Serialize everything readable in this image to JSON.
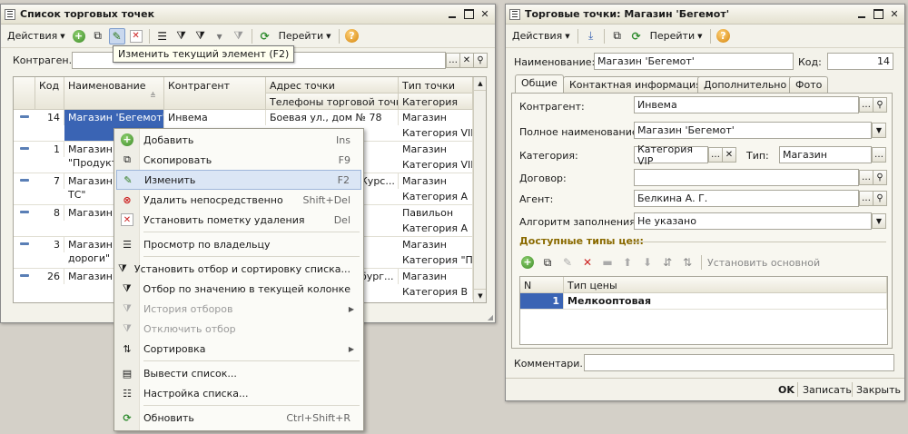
{
  "left_window": {
    "title": "Список торговых точек",
    "toolbar": {
      "actions_label": "Действия",
      "goto_label": "Перейти"
    },
    "filter": {
      "label": "Контраген...",
      "value": ""
    },
    "tooltip": "Изменить текущий элемент (F2)",
    "columns": {
      "code": "Код",
      "name": "Наименование",
      "counterparty": "Контрагент",
      "address": "Адрес точки",
      "phones": "Телефоны торговой точки",
      "point_type": "Тип точки",
      "category": "Категория"
    },
    "rows": [
      {
        "code": "14",
        "name": "Магазин 'Бегемот'",
        "name2": "",
        "counterparty": "Инвема",
        "address": "Боевая ул., дом № 78",
        "type": "Магазин",
        "category": "Категория VIP"
      },
      {
        "code": "1",
        "name": "Магазин",
        "name2": "\"Продукть",
        "counterparty": "",
        "address": "",
        "type": "Магазин",
        "category": "Категория VIP"
      },
      {
        "code": "7",
        "name": "Магазин \"",
        "name2": "ТС\"",
        "counterparty": "",
        "address": "Курс...",
        "type": "Магазин",
        "category": "Категория А"
      },
      {
        "code": "8",
        "name": "Магазин '",
        "name2": "",
        "counterparty": "",
        "address": "",
        "type": "Павильон",
        "category": "Категория А"
      },
      {
        "code": "3",
        "name": "Магазин \"",
        "name2": "дороги\"",
        "counterparty": "",
        "address": "",
        "type": "Магазин",
        "category": "Категория \"Пот"
      },
      {
        "code": "26",
        "name": "Магазин '",
        "name2": "",
        "counterparty": "",
        "address": "бург...",
        "type": "Магазин",
        "category": "Категория В"
      }
    ]
  },
  "context_menu": {
    "items": [
      {
        "label": "Добавить",
        "shortcut": "Ins",
        "icon": "add-icon"
      },
      {
        "label": "Скопировать",
        "shortcut": "F9",
        "icon": "copy-icon"
      },
      {
        "label": "Изменить",
        "shortcut": "F2",
        "icon": "edit-icon"
      },
      {
        "label": "Удалить непосредственно",
        "shortcut": "Shift+Del",
        "icon": "delete-icon"
      },
      {
        "label": "Установить пометку удаления",
        "shortcut": "Del",
        "icon": "mark-delete-icon"
      },
      {
        "label": "Просмотр по владельцу",
        "shortcut": "",
        "icon": "owner-view-icon"
      },
      {
        "label": "Установить отбор и сортировку списка...",
        "shortcut": "",
        "icon": "filter-sort-icon"
      },
      {
        "label": "Отбор по значению в текущей колонке",
        "shortcut": "",
        "icon": "filter-value-icon"
      },
      {
        "label": "История отборов",
        "shortcut": "",
        "icon": "filter-history-icon"
      },
      {
        "label": "Отключить отбор",
        "shortcut": "",
        "icon": "filter-off-icon"
      },
      {
        "label": "Сортировка",
        "shortcut": "",
        "icon": "sort-icon"
      },
      {
        "label": "Вывести список...",
        "shortcut": "",
        "icon": "print-list-icon"
      },
      {
        "label": "Настройка списка...",
        "shortcut": "",
        "icon": "list-settings-icon"
      },
      {
        "label": "Обновить",
        "shortcut": "Ctrl+Shift+R",
        "icon": "refresh-icon"
      }
    ]
  },
  "right_window": {
    "title": "Торговые точки: Магазин 'Бегемот'",
    "toolbar": {
      "actions_label": "Действия",
      "goto_label": "Перейти"
    },
    "name_label": "Наименование:",
    "name_value": "Магазин 'Бегемот'",
    "code_label": "Код:",
    "code_value": "14",
    "tabs": [
      "Общие",
      "Контактная информация",
      "Дополнительно",
      "Фото"
    ],
    "form": {
      "counterparty_label": "Контрагент:",
      "counterparty_value": "Инвема",
      "full_name_label": "Полное наименование:",
      "full_name_value": "Магазин 'Бегемот'",
      "category_label": "Категория:",
      "category_value": "Категория VIP",
      "type_label": "Тип:",
      "type_value": "Магазин",
      "contract_label": "Договор:",
      "contract_value": "",
      "agent_label": "Агент:",
      "agent_value": "Белкина А. Г.",
      "fill_algo_label": "Алгоритм заполнения:",
      "fill_algo_value": "Не указано"
    },
    "price_types": {
      "section_title": "Доступные типы цен:",
      "set_main_label": "Установить основной",
      "col_n": "N",
      "col_type": "Тип цены",
      "rows": [
        {
          "n": "1",
          "type": "Мелкооптовая"
        }
      ]
    },
    "comment_label": "Комментари...",
    "comment_value": "",
    "buttons": {
      "ok": "OK",
      "save": "Записать",
      "close": "Закрыть"
    }
  },
  "colors": {
    "selection": "#3a64b4",
    "accent_section": "#8a6a00",
    "background": "#d4d0c8"
  }
}
